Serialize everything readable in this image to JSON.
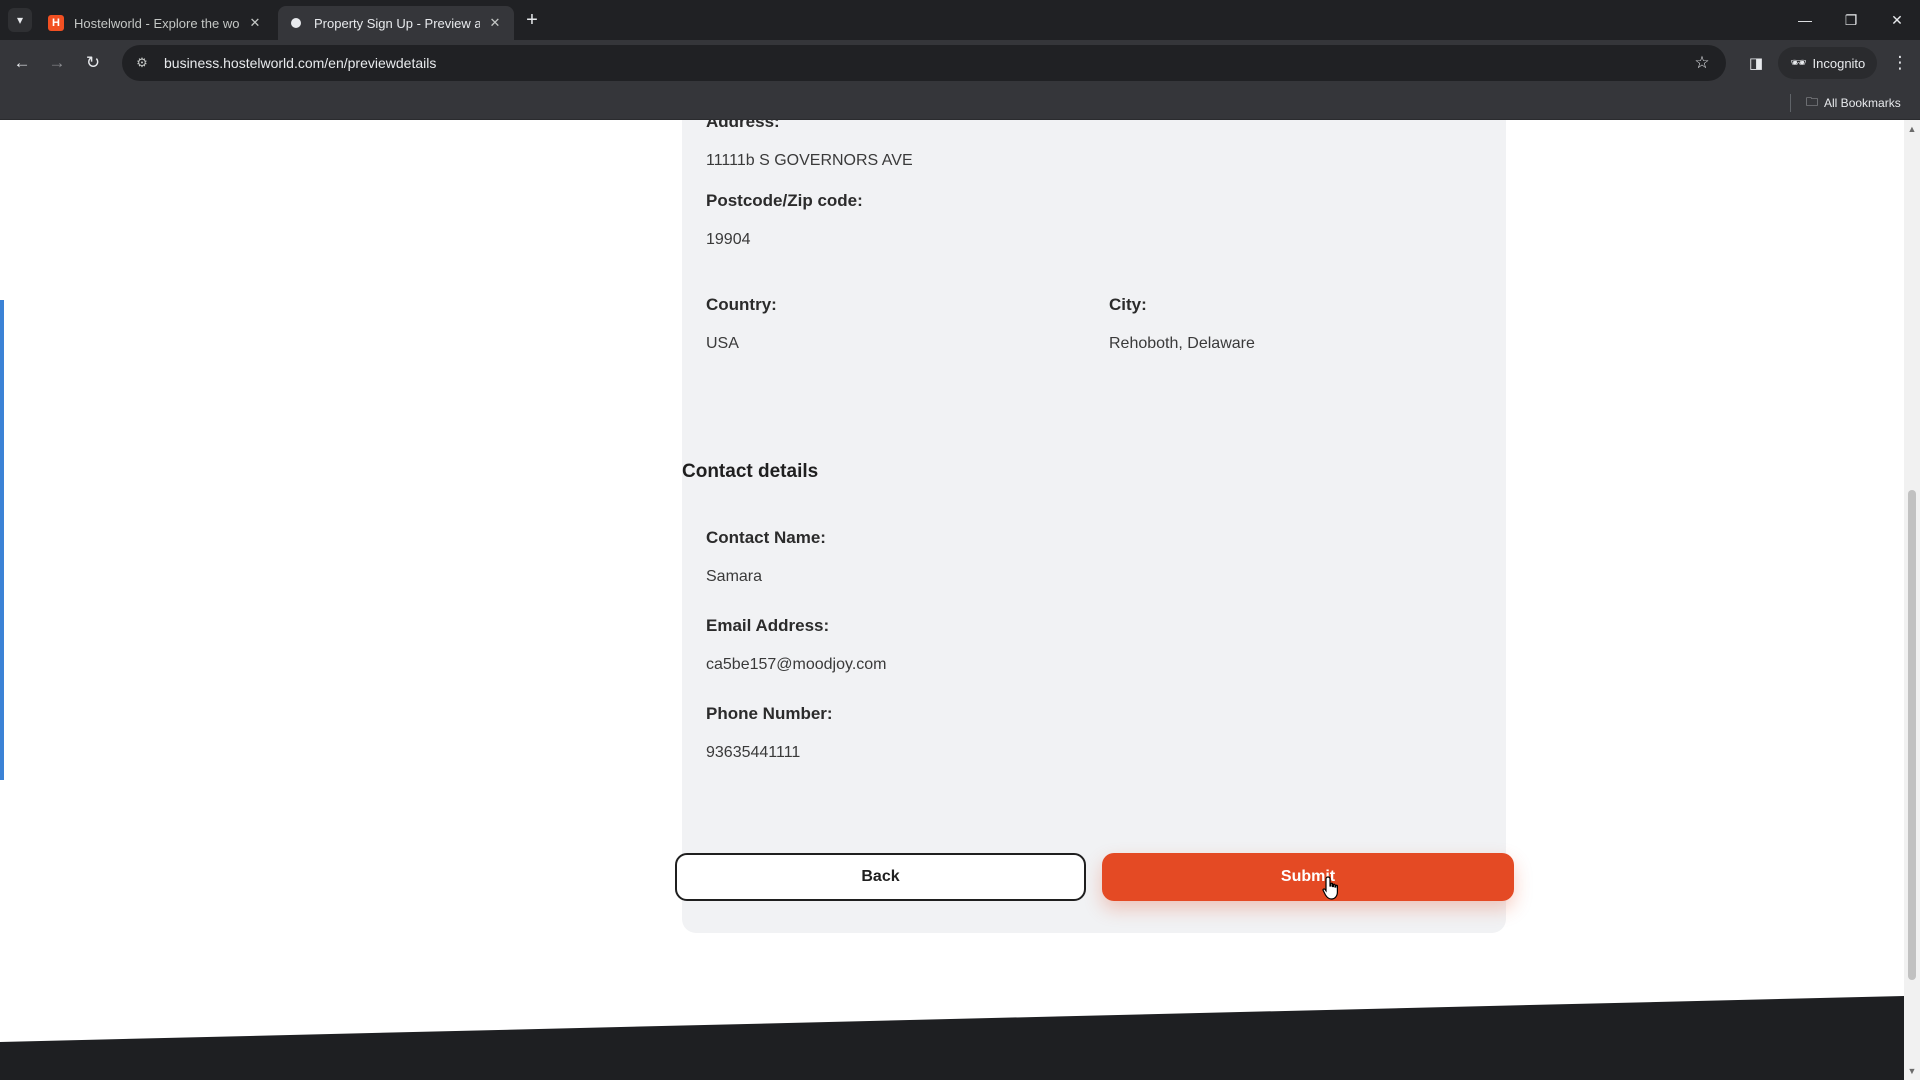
{
  "browser": {
    "tabs": [
      {
        "title": "Hostelworld - Explore the world",
        "favicon": "hostelworld-logo"
      },
      {
        "title": "Property Sign Up - Preview and",
        "favicon": "dot"
      }
    ],
    "url": "business.hostelworld.com/en/previewdetails",
    "incognito_label": "Incognito",
    "bookmarks_label": "All Bookmarks"
  },
  "location": {
    "address_label": "Address:",
    "address_value": "11111b S GOVERNORS AVE",
    "postcode_label": "Postcode/Zip code:",
    "postcode_value": "19904",
    "country_label": "Country:",
    "country_value": "USA",
    "city_label": "City:",
    "city_value": "Rehoboth, Delaware"
  },
  "contact": {
    "section_title": "Contact details",
    "name_label": "Contact Name:",
    "name_value": "Samara",
    "email_label": "Email Address:",
    "email_value": "ca5be157@moodjoy.com",
    "phone_label": "Phone Number:",
    "phone_value": "93635441111"
  },
  "actions": {
    "back_label": "Back",
    "submit_label": "Submit"
  },
  "colors": {
    "accent": "#e44a24",
    "card_bg": "#f1f2f4",
    "footer": "#1e1f22",
    "left_accent": "#3b82d6"
  }
}
